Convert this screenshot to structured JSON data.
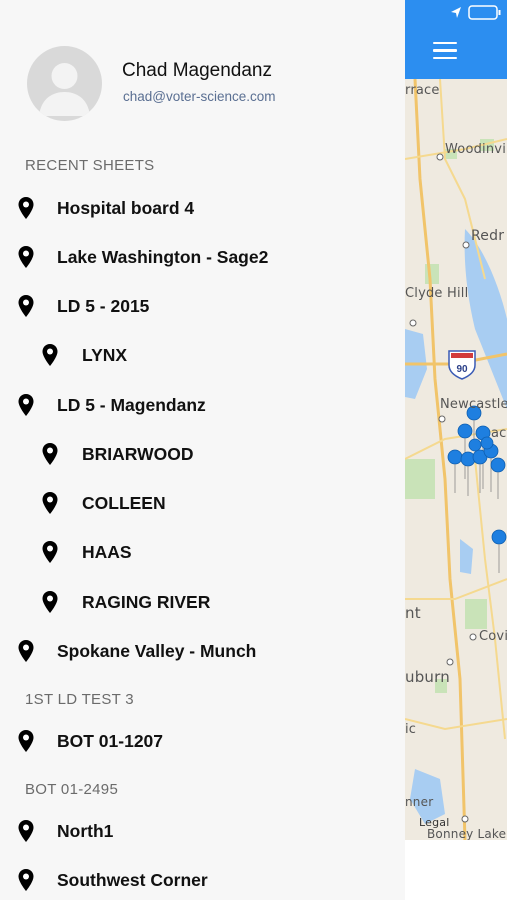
{
  "user": {
    "name": "Chad Magendanz",
    "email": "chad@voter-science.com"
  },
  "sections": {
    "recent": "RECENT SHEETS",
    "ld_test": "1ST LD TEST 3",
    "bot": "BOT 01-2495"
  },
  "items": [
    {
      "label": "Hospital board 4"
    },
    {
      "label": "Lake Washington - Sage2"
    },
    {
      "label": "LD 5 - 2015"
    },
    {
      "label": "LYNX"
    },
    {
      "label": "LD 5 - Magendanz"
    },
    {
      "label": "BRIARWOOD"
    },
    {
      "label": "COLLEEN"
    },
    {
      "label": "HAAS"
    },
    {
      "label": "RAGING RIVER"
    },
    {
      "label": "Spokane Valley - Munch"
    },
    {
      "label": "BOT 01-1207"
    },
    {
      "label": "North1"
    },
    {
      "label": "Southwest Corner"
    }
  ],
  "map": {
    "labels": [
      "rrace",
      "Woodinvi",
      "Redr",
      "Clyde Hill",
      "Newcastle",
      "ac",
      "nt",
      "Covi",
      "uburn",
      "ic",
      "nner",
      "Legal",
      "Bonney Lake"
    ],
    "highway": "90"
  },
  "colors": {
    "accent": "#2c8ef0",
    "pin": "#1e7fe0"
  }
}
